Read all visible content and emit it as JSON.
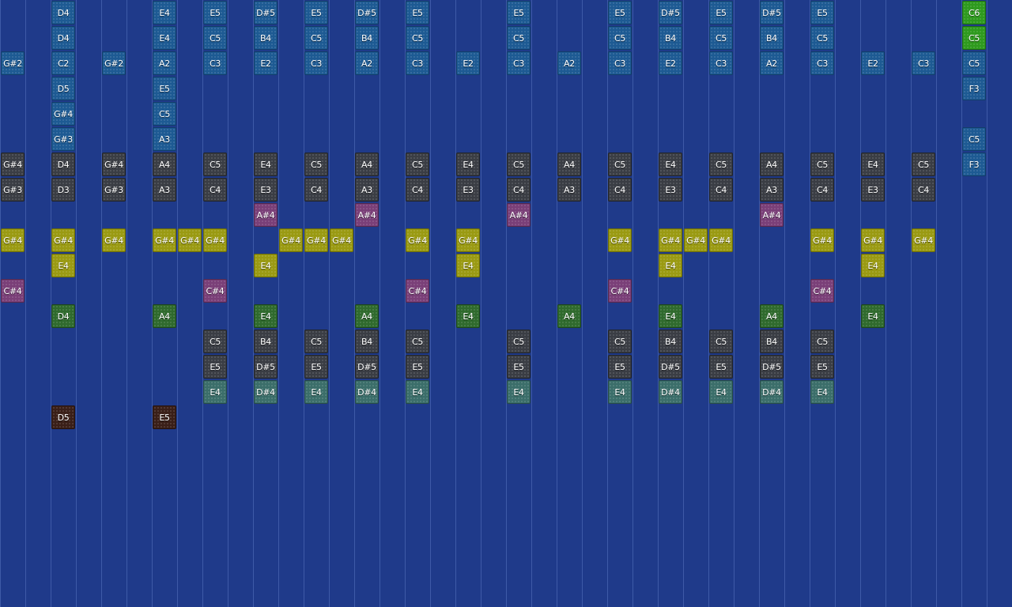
{
  "grid": {
    "background": "#1f3a8a",
    "line_color": "#5a73bd"
  },
  "colors": {
    "blue": "#1d5a93",
    "gray": "#3a3d44",
    "yellow": "#9a9a12",
    "purple": "#7a3f78",
    "green": "#2f6a2d",
    "teal": "#3b6e6a",
    "brown": "#3a1f18",
    "lime": "#2e9a1e"
  },
  "notes": [
    {
      "col": 2,
      "row": 0,
      "label": "D4",
      "color": "blue"
    },
    {
      "col": 6,
      "row": 0,
      "label": "E4",
      "color": "blue"
    },
    {
      "col": 8,
      "row": 0,
      "label": "E5",
      "color": "blue"
    },
    {
      "col": 10,
      "row": 0,
      "label": "D#5",
      "color": "blue"
    },
    {
      "col": 12,
      "row": 0,
      "label": "E5",
      "color": "blue"
    },
    {
      "col": 14,
      "row": 0,
      "label": "D#5",
      "color": "blue"
    },
    {
      "col": 16,
      "row": 0,
      "label": "E5",
      "color": "blue"
    },
    {
      "col": 20,
      "row": 0,
      "label": "E5",
      "color": "blue"
    },
    {
      "col": 24,
      "row": 0,
      "label": "E5",
      "color": "blue"
    },
    {
      "col": 26,
      "row": 0,
      "label": "D#5",
      "color": "blue"
    },
    {
      "col": 28,
      "row": 0,
      "label": "E5",
      "color": "blue"
    },
    {
      "col": 30,
      "row": 0,
      "label": "D#5",
      "color": "blue"
    },
    {
      "col": 32,
      "row": 0,
      "label": "E5",
      "color": "blue"
    },
    {
      "col": 38,
      "row": 0,
      "label": "C6",
      "color": "lime"
    },
    {
      "col": 2,
      "row": 1,
      "label": "D4",
      "color": "blue"
    },
    {
      "col": 6,
      "row": 1,
      "label": "E4",
      "color": "blue"
    },
    {
      "col": 8,
      "row": 1,
      "label": "C5",
      "color": "blue"
    },
    {
      "col": 10,
      "row": 1,
      "label": "B4",
      "color": "blue"
    },
    {
      "col": 12,
      "row": 1,
      "label": "C5",
      "color": "blue"
    },
    {
      "col": 14,
      "row": 1,
      "label": "B4",
      "color": "blue"
    },
    {
      "col": 16,
      "row": 1,
      "label": "C5",
      "color": "blue"
    },
    {
      "col": 20,
      "row": 1,
      "label": "C5",
      "color": "blue"
    },
    {
      "col": 24,
      "row": 1,
      "label": "C5",
      "color": "blue"
    },
    {
      "col": 26,
      "row": 1,
      "label": "B4",
      "color": "blue"
    },
    {
      "col": 28,
      "row": 1,
      "label": "C5",
      "color": "blue"
    },
    {
      "col": 30,
      "row": 1,
      "label": "B4",
      "color": "blue"
    },
    {
      "col": 32,
      "row": 1,
      "label": "C5",
      "color": "blue"
    },
    {
      "col": 38,
      "row": 1,
      "label": "C5",
      "color": "lime"
    },
    {
      "col": 0,
      "row": 2,
      "label": "G#2",
      "color": "blue"
    },
    {
      "col": 2,
      "row": 2,
      "label": "C2",
      "color": "blue"
    },
    {
      "col": 4,
      "row": 2,
      "label": "G#2",
      "color": "blue"
    },
    {
      "col": 6,
      "row": 2,
      "label": "A2",
      "color": "blue"
    },
    {
      "col": 8,
      "row": 2,
      "label": "C3",
      "color": "blue"
    },
    {
      "col": 10,
      "row": 2,
      "label": "E2",
      "color": "blue"
    },
    {
      "col": 12,
      "row": 2,
      "label": "C3",
      "color": "blue"
    },
    {
      "col": 14,
      "row": 2,
      "label": "A2",
      "color": "blue"
    },
    {
      "col": 16,
      "row": 2,
      "label": "C3",
      "color": "blue"
    },
    {
      "col": 18,
      "row": 2,
      "label": "E2",
      "color": "blue"
    },
    {
      "col": 20,
      "row": 2,
      "label": "C3",
      "color": "blue"
    },
    {
      "col": 22,
      "row": 2,
      "label": "A2",
      "color": "blue"
    },
    {
      "col": 24,
      "row": 2,
      "label": "C3",
      "color": "blue"
    },
    {
      "col": 26,
      "row": 2,
      "label": "E2",
      "color": "blue"
    },
    {
      "col": 28,
      "row": 2,
      "label": "C3",
      "color": "blue"
    },
    {
      "col": 30,
      "row": 2,
      "label": "A2",
      "color": "blue"
    },
    {
      "col": 32,
      "row": 2,
      "label": "C3",
      "color": "blue"
    },
    {
      "col": 34,
      "row": 2,
      "label": "E2",
      "color": "blue"
    },
    {
      "col": 36,
      "row": 2,
      "label": "C3",
      "color": "blue"
    },
    {
      "col": 38,
      "row": 2,
      "label": "C5",
      "color": "blue"
    },
    {
      "col": 2,
      "row": 3,
      "label": "D5",
      "color": "blue"
    },
    {
      "col": 6,
      "row": 3,
      "label": "E5",
      "color": "blue"
    },
    {
      "col": 38,
      "row": 3,
      "label": "F3",
      "color": "blue"
    },
    {
      "col": 2,
      "row": 4,
      "label": "G#4",
      "color": "blue"
    },
    {
      "col": 6,
      "row": 4,
      "label": "C5",
      "color": "blue"
    },
    {
      "col": 2,
      "row": 5,
      "label": "G#3",
      "color": "blue"
    },
    {
      "col": 6,
      "row": 5,
      "label": "A3",
      "color": "blue"
    },
    {
      "col": 38,
      "row": 5,
      "label": "C5",
      "color": "blue"
    },
    {
      "col": 0,
      "row": 6,
      "label": "G#4",
      "color": "gray"
    },
    {
      "col": 2,
      "row": 6,
      "label": "D4",
      "color": "gray"
    },
    {
      "col": 4,
      "row": 6,
      "label": "G#4",
      "color": "gray"
    },
    {
      "col": 6,
      "row": 6,
      "label": "A4",
      "color": "gray"
    },
    {
      "col": 8,
      "row": 6,
      "label": "C5",
      "color": "gray"
    },
    {
      "col": 10,
      "row": 6,
      "label": "E4",
      "color": "gray"
    },
    {
      "col": 12,
      "row": 6,
      "label": "C5",
      "color": "gray"
    },
    {
      "col": 14,
      "row": 6,
      "label": "A4",
      "color": "gray"
    },
    {
      "col": 16,
      "row": 6,
      "label": "C5",
      "color": "gray"
    },
    {
      "col": 18,
      "row": 6,
      "label": "E4",
      "color": "gray"
    },
    {
      "col": 20,
      "row": 6,
      "label": "C5",
      "color": "gray"
    },
    {
      "col": 22,
      "row": 6,
      "label": "A4",
      "color": "gray"
    },
    {
      "col": 24,
      "row": 6,
      "label": "C5",
      "color": "gray"
    },
    {
      "col": 26,
      "row": 6,
      "label": "E4",
      "color": "gray"
    },
    {
      "col": 28,
      "row": 6,
      "label": "C5",
      "color": "gray"
    },
    {
      "col": 30,
      "row": 6,
      "label": "A4",
      "color": "gray"
    },
    {
      "col": 32,
      "row": 6,
      "label": "C5",
      "color": "gray"
    },
    {
      "col": 34,
      "row": 6,
      "label": "E4",
      "color": "gray"
    },
    {
      "col": 36,
      "row": 6,
      "label": "C5",
      "color": "gray"
    },
    {
      "col": 38,
      "row": 6,
      "label": "F3",
      "color": "blue"
    },
    {
      "col": 0,
      "row": 7,
      "label": "G#3",
      "color": "gray"
    },
    {
      "col": 2,
      "row": 7,
      "label": "D3",
      "color": "gray"
    },
    {
      "col": 4,
      "row": 7,
      "label": "G#3",
      "color": "gray"
    },
    {
      "col": 6,
      "row": 7,
      "label": "A3",
      "color": "gray"
    },
    {
      "col": 8,
      "row": 7,
      "label": "C4",
      "color": "gray"
    },
    {
      "col": 10,
      "row": 7,
      "label": "E3",
      "color": "gray"
    },
    {
      "col": 12,
      "row": 7,
      "label": "C4",
      "color": "gray"
    },
    {
      "col": 14,
      "row": 7,
      "label": "A3",
      "color": "gray"
    },
    {
      "col": 16,
      "row": 7,
      "label": "C4",
      "color": "gray"
    },
    {
      "col": 18,
      "row": 7,
      "label": "E3",
      "color": "gray"
    },
    {
      "col": 20,
      "row": 7,
      "label": "C4",
      "color": "gray"
    },
    {
      "col": 22,
      "row": 7,
      "label": "A3",
      "color": "gray"
    },
    {
      "col": 24,
      "row": 7,
      "label": "C4",
      "color": "gray"
    },
    {
      "col": 26,
      "row": 7,
      "label": "E3",
      "color": "gray"
    },
    {
      "col": 28,
      "row": 7,
      "label": "C4",
      "color": "gray"
    },
    {
      "col": 30,
      "row": 7,
      "label": "A3",
      "color": "gray"
    },
    {
      "col": 32,
      "row": 7,
      "label": "C4",
      "color": "gray"
    },
    {
      "col": 34,
      "row": 7,
      "label": "E3",
      "color": "gray"
    },
    {
      "col": 36,
      "row": 7,
      "label": "C4",
      "color": "gray"
    },
    {
      "col": 10,
      "row": 8,
      "label": "A#4",
      "color": "purple"
    },
    {
      "col": 14,
      "row": 8,
      "label": "A#4",
      "color": "purple"
    },
    {
      "col": 20,
      "row": 8,
      "label": "A#4",
      "color": "purple"
    },
    {
      "col": 30,
      "row": 8,
      "label": "A#4",
      "color": "purple"
    },
    {
      "col": 0,
      "row": 9,
      "label": "G#4",
      "color": "yellow"
    },
    {
      "col": 2,
      "row": 9,
      "label": "G#4",
      "color": "yellow"
    },
    {
      "col": 4,
      "row": 9,
      "label": "G#4",
      "color": "yellow"
    },
    {
      "col": 6,
      "row": 9,
      "label": "G#4",
      "color": "yellow"
    },
    {
      "col": 7,
      "row": 9,
      "label": "G#4",
      "color": "yellow"
    },
    {
      "col": 8,
      "row": 9,
      "label": "G#4",
      "color": "yellow"
    },
    {
      "col": 11,
      "row": 9,
      "label": "G#4",
      "color": "yellow"
    },
    {
      "col": 12,
      "row": 9,
      "label": "G#4",
      "color": "yellow"
    },
    {
      "col": 13,
      "row": 9,
      "label": "G#4",
      "color": "yellow"
    },
    {
      "col": 16,
      "row": 9,
      "label": "G#4",
      "color": "yellow"
    },
    {
      "col": 18,
      "row": 9,
      "label": "G#4",
      "color": "yellow"
    },
    {
      "col": 24,
      "row": 9,
      "label": "G#4",
      "color": "yellow"
    },
    {
      "col": 26,
      "row": 9,
      "label": "G#4",
      "color": "yellow"
    },
    {
      "col": 27,
      "row": 9,
      "label": "G#4",
      "color": "yellow"
    },
    {
      "col": 28,
      "row": 9,
      "label": "G#4",
      "color": "yellow"
    },
    {
      "col": 32,
      "row": 9,
      "label": "G#4",
      "color": "yellow"
    },
    {
      "col": 34,
      "row": 9,
      "label": "G#4",
      "color": "yellow"
    },
    {
      "col": 36,
      "row": 9,
      "label": "G#4",
      "color": "yellow"
    },
    {
      "col": 2,
      "row": 10,
      "label": "E4",
      "color": "yellow"
    },
    {
      "col": 10,
      "row": 10,
      "label": "E4",
      "color": "yellow"
    },
    {
      "col": 18,
      "row": 10,
      "label": "E4",
      "color": "yellow"
    },
    {
      "col": 26,
      "row": 10,
      "label": "E4",
      "color": "yellow"
    },
    {
      "col": 34,
      "row": 10,
      "label": "E4",
      "color": "yellow"
    },
    {
      "col": 0,
      "row": 11,
      "label": "C#4",
      "color": "purple"
    },
    {
      "col": 8,
      "row": 11,
      "label": "C#4",
      "color": "purple"
    },
    {
      "col": 16,
      "row": 11,
      "label": "C#4",
      "color": "purple"
    },
    {
      "col": 24,
      "row": 11,
      "label": "C#4",
      "color": "purple"
    },
    {
      "col": 32,
      "row": 11,
      "label": "C#4",
      "color": "purple"
    },
    {
      "col": 2,
      "row": 12,
      "label": "D4",
      "color": "green"
    },
    {
      "col": 6,
      "row": 12,
      "label": "A4",
      "color": "green"
    },
    {
      "col": 10,
      "row": 12,
      "label": "E4",
      "color": "green"
    },
    {
      "col": 14,
      "row": 12,
      "label": "A4",
      "color": "green"
    },
    {
      "col": 18,
      "row": 12,
      "label": "E4",
      "color": "green"
    },
    {
      "col": 22,
      "row": 12,
      "label": "A4",
      "color": "green"
    },
    {
      "col": 26,
      "row": 12,
      "label": "E4",
      "color": "green"
    },
    {
      "col": 30,
      "row": 12,
      "label": "A4",
      "color": "green"
    },
    {
      "col": 34,
      "row": 12,
      "label": "E4",
      "color": "green"
    },
    {
      "col": 8,
      "row": 13,
      "label": "C5",
      "color": "gray"
    },
    {
      "col": 10,
      "row": 13,
      "label": "B4",
      "color": "gray"
    },
    {
      "col": 12,
      "row": 13,
      "label": "C5",
      "color": "gray"
    },
    {
      "col": 14,
      "row": 13,
      "label": "B4",
      "color": "gray"
    },
    {
      "col": 16,
      "row": 13,
      "label": "C5",
      "color": "gray"
    },
    {
      "col": 20,
      "row": 13,
      "label": "C5",
      "color": "gray"
    },
    {
      "col": 24,
      "row": 13,
      "label": "C5",
      "color": "gray"
    },
    {
      "col": 26,
      "row": 13,
      "label": "B4",
      "color": "gray"
    },
    {
      "col": 28,
      "row": 13,
      "label": "C5",
      "color": "gray"
    },
    {
      "col": 30,
      "row": 13,
      "label": "B4",
      "color": "gray"
    },
    {
      "col": 32,
      "row": 13,
      "label": "C5",
      "color": "gray"
    },
    {
      "col": 8,
      "row": 14,
      "label": "E5",
      "color": "gray"
    },
    {
      "col": 10,
      "row": 14,
      "label": "D#5",
      "color": "gray"
    },
    {
      "col": 12,
      "row": 14,
      "label": "E5",
      "color": "gray"
    },
    {
      "col": 14,
      "row": 14,
      "label": "D#5",
      "color": "gray"
    },
    {
      "col": 16,
      "row": 14,
      "label": "E5",
      "color": "gray"
    },
    {
      "col": 20,
      "row": 14,
      "label": "E5",
      "color": "gray"
    },
    {
      "col": 24,
      "row": 14,
      "label": "E5",
      "color": "gray"
    },
    {
      "col": 26,
      "row": 14,
      "label": "D#5",
      "color": "gray"
    },
    {
      "col": 28,
      "row": 14,
      "label": "E5",
      "color": "gray"
    },
    {
      "col": 30,
      "row": 14,
      "label": "D#5",
      "color": "gray"
    },
    {
      "col": 32,
      "row": 14,
      "label": "E5",
      "color": "gray"
    },
    {
      "col": 8,
      "row": 15,
      "label": "E4",
      "color": "teal"
    },
    {
      "col": 10,
      "row": 15,
      "label": "D#4",
      "color": "teal"
    },
    {
      "col": 12,
      "row": 15,
      "label": "E4",
      "color": "teal"
    },
    {
      "col": 14,
      "row": 15,
      "label": "D#4",
      "color": "teal"
    },
    {
      "col": 16,
      "row": 15,
      "label": "E4",
      "color": "teal"
    },
    {
      "col": 20,
      "row": 15,
      "label": "E4",
      "color": "teal"
    },
    {
      "col": 24,
      "row": 15,
      "label": "E4",
      "color": "teal"
    },
    {
      "col": 26,
      "row": 15,
      "label": "D#4",
      "color": "teal"
    },
    {
      "col": 28,
      "row": 15,
      "label": "E4",
      "color": "teal"
    },
    {
      "col": 30,
      "row": 15,
      "label": "D#4",
      "color": "teal"
    },
    {
      "col": 32,
      "row": 15,
      "label": "E4",
      "color": "teal"
    },
    {
      "col": 2,
      "row": 16,
      "label": "D5",
      "color": "brown"
    },
    {
      "col": 6,
      "row": 16,
      "label": "E5",
      "color": "brown"
    }
  ]
}
